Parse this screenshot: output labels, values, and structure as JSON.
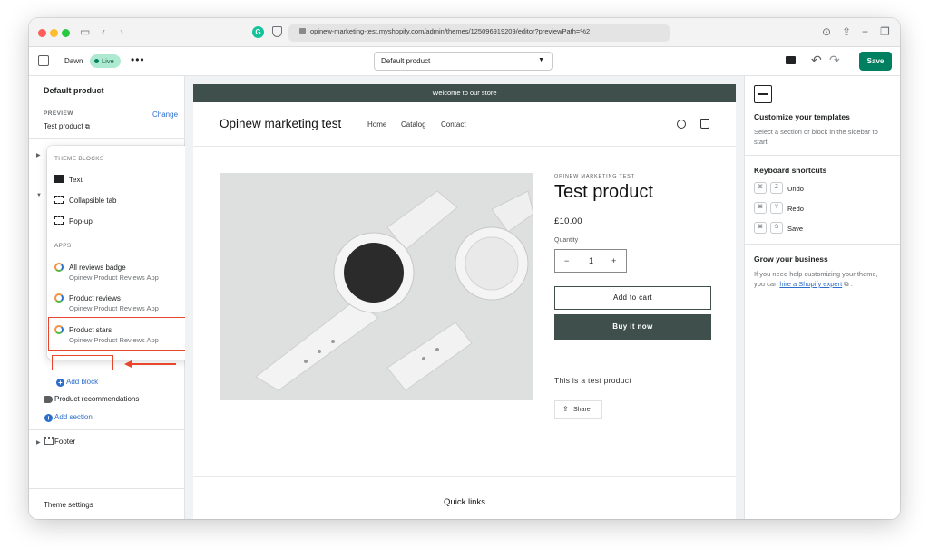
{
  "browser": {
    "url": "opinew-marketing-test.myshopify.com/admin/themes/125096919209/editor?previewPath=%2"
  },
  "topbar": {
    "theme_name": "Dawn",
    "live_badge": "Live",
    "template_selected": "Default product",
    "save_label": "Save"
  },
  "sidebar": {
    "title": "Default product",
    "preview_label": "PREVIEW",
    "preview_value": "Test product",
    "change_link": "Change",
    "add_block": "Add block",
    "product_recommendations": "Product recommendations",
    "add_section": "Add section",
    "footer": "Footer",
    "theme_settings": "Theme settings"
  },
  "popover": {
    "theme_blocks_heading": "THEME BLOCKS",
    "theme_blocks": [
      {
        "label": "Text",
        "icon": "text-block-icon"
      },
      {
        "label": "Collapsible tab",
        "icon": "collapsible-tab-icon"
      },
      {
        "label": "Pop-up",
        "icon": "popup-icon"
      }
    ],
    "apps_heading": "APPS",
    "apps": [
      {
        "label": "All reviews badge",
        "sub": "Opinew Product Reviews App"
      },
      {
        "label": "Product reviews",
        "sub": "Opinew Product Reviews App"
      },
      {
        "label": "Product stars",
        "sub": "Opinew Product Reviews App"
      }
    ]
  },
  "store": {
    "announcement": "Welcome to our store",
    "name": "Opinew marketing test",
    "nav": [
      "Home",
      "Catalog",
      "Contact"
    ],
    "vendor": "OPINEW MARKETING TEST",
    "product_title": "Test product",
    "price": "£10.00",
    "quantity_label": "Quantity",
    "quantity_value": "1",
    "minus": "−",
    "plus": "+",
    "add_to_cart": "Add to cart",
    "buy_now": "Buy it now",
    "description": "This is a test product",
    "share": "Share",
    "quick_links": "Quick links"
  },
  "right_panel": {
    "customize_title": "Customize your templates",
    "customize_text": "Select a section or block in the sidebar to start.",
    "shortcuts_title": "Keyboard shortcuts",
    "shortcuts": [
      {
        "mod": "⌘",
        "key": "Z",
        "label": "Undo"
      },
      {
        "mod": "⌘",
        "key": "Y",
        "label": "Redo"
      },
      {
        "mod": "⌘",
        "key": "S",
        "label": "Save"
      }
    ],
    "grow_title": "Grow your business",
    "grow_text_before": "If you need help customizing your theme, you can ",
    "grow_link": "hire a Shopify expert",
    "grow_text_after": " ."
  },
  "colors": {
    "accent": "#008060",
    "link": "#2c6ecb",
    "annotation": "#e8452c",
    "store_dark": "#3f504c"
  }
}
